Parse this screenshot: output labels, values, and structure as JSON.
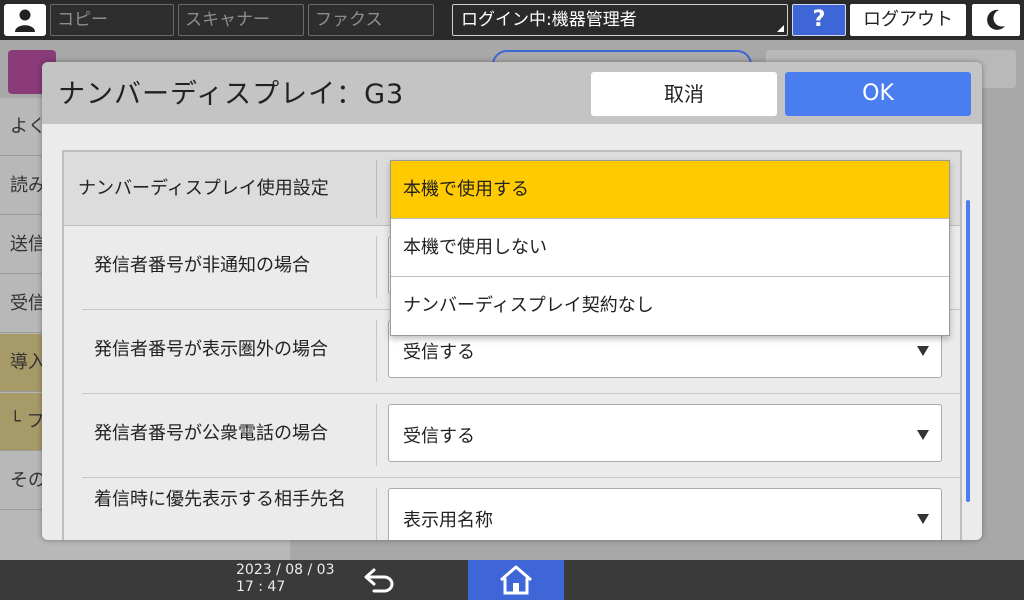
{
  "topbar": {
    "apps": [
      "コピー",
      "スキャナー",
      "ファクス"
    ],
    "login_status": "ログイン中:機器管理者",
    "help_label": "?",
    "logout_label": "ログアウト"
  },
  "background": {
    "sidebar_items": [
      "よく",
      "読み",
      "送信",
      "受信",
      "導入",
      "└ フ",
      "その"
    ]
  },
  "dialog": {
    "title": "ナンバーディスプレイ：G3",
    "cancel_label": "取消",
    "ok_label": "OK",
    "main_setting_label": "ナンバーディスプレイ使用設定",
    "rows": [
      {
        "label": "発信者番号が非通知の場合",
        "value": ""
      },
      {
        "label": "発信者番号が表示圏外の場合",
        "value": "受信する"
      },
      {
        "label": "発信者番号が公衆電話の場合",
        "value": "受信する"
      },
      {
        "label": "着信時に優先表示する相手先名",
        "value": "表示用名称"
      }
    ],
    "dropdown_options": [
      "本機で使用する",
      "本機で使用しない",
      "ナンバーディスプレイ契約なし"
    ],
    "dropdown_selected_index": 0
  },
  "bottombar": {
    "date": "2023 / 08 / 03",
    "time": "17 : 47"
  },
  "colors": {
    "accent_blue": "#4a7df0",
    "selected_yellow": "#ffcb00"
  }
}
